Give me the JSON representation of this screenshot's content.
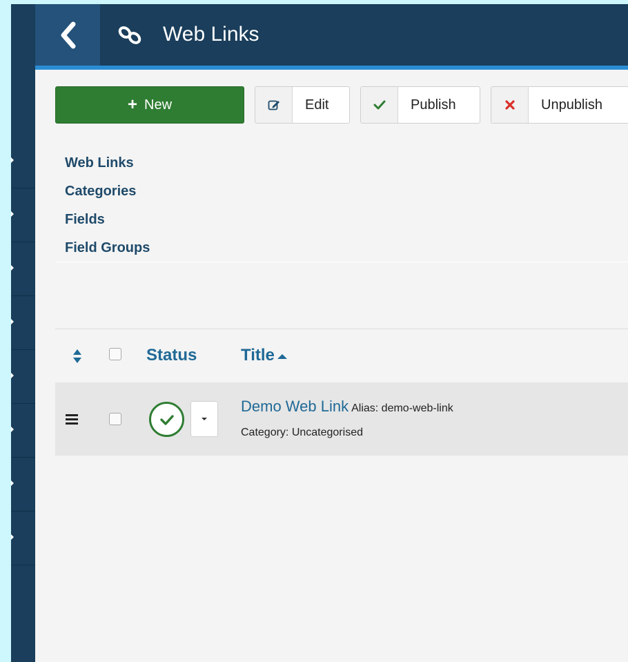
{
  "header": {
    "title": "Web Links",
    "icons": {
      "back": "chevron-left-icon",
      "module": "link-icon"
    }
  },
  "toolbar": {
    "new_label": "New",
    "edit_label": "Edit",
    "publish_label": "Publish",
    "unpublish_label": "Unpublish"
  },
  "submenu": {
    "items": [
      {
        "label": "Web Links"
      },
      {
        "label": "Categories"
      },
      {
        "label": "Fields"
      },
      {
        "label": "Field Groups"
      }
    ]
  },
  "table": {
    "columns": {
      "status": "Status",
      "title": "Title"
    },
    "sort": {
      "column": "title",
      "direction": "asc"
    },
    "rows": [
      {
        "title": "Demo Web Link",
        "alias": "Alias: demo-web-link",
        "category": "Category: Uncategorised",
        "status": "published"
      }
    ]
  },
  "colors": {
    "header_bg": "#1a3e5b",
    "accent": "#2a8dd4",
    "new_button": "#2f7d32",
    "link": "#1f6996",
    "unpublish_icon": "#d9302a"
  }
}
